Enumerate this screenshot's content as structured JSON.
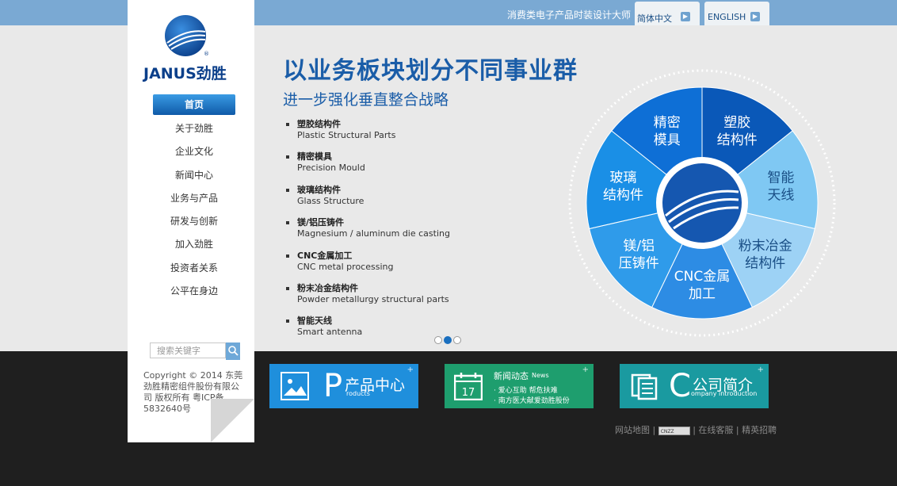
{
  "header": {
    "slogan": "消费类电子产品时装设计大师",
    "lang_cn": "简体中文",
    "lang_en": "ENGLISH"
  },
  "logo": {
    "brand_text": "JANUS劲胜"
  },
  "nav": {
    "items": [
      "首页",
      "关于劲胜",
      "企业文化",
      "新闻中心",
      "业务与产品",
      "研发与创新",
      "加入劲胜",
      "投资者关系",
      "公平在身边"
    ]
  },
  "search": {
    "placeholder": "搜索关键字"
  },
  "copyright": "Copyright © 2014 东莞劲胜精密组件股份有限公司 版权所有 粤ICP备5832640号",
  "banner": {
    "headline": "以业务板块划分不同事业群",
    "subhead": "进一步强化垂直整合战略",
    "businesses": [
      {
        "cn": "塑胶结构件",
        "en": "Plastic Structural Parts"
      },
      {
        "cn": "精密模具",
        "en": "Precision Mould"
      },
      {
        "cn": "玻璃结构件",
        "en": "Glass Structure"
      },
      {
        "cn": "镁/铝压铸件",
        "en": "Magnesium / aluminum die casting"
      },
      {
        "cn": "CNC金属加工",
        "en": "CNC metal processing"
      },
      {
        "cn": "粉末冶金结构件",
        "en": "Powder metallurgy structural parts"
      },
      {
        "cn": "智能天线",
        "en": "Smart antenna"
      }
    ],
    "wheel": [
      {
        "l1": "塑胶",
        "l2": "结构件",
        "color": "#0a58b8"
      },
      {
        "l1": "智能",
        "l2": "天线",
        "color": "#7fc8f3"
      },
      {
        "l1": "粉末冶金",
        "l2": "结构件",
        "color": "#9dd2f5"
      },
      {
        "l1": "CNC金属",
        "l2": "加工",
        "color": "#2d8ce4"
      },
      {
        "l1": "镁/铝",
        "l2": "压铸件",
        "color": "#2f9bea"
      },
      {
        "l1": "玻璃",
        "l2": "结构件",
        "color": "#1a8fe6"
      },
      {
        "l1": "精密",
        "l2": "模具",
        "color": "#0e6fd6"
      }
    ],
    "slide_count": 3,
    "active_slide": 2
  },
  "cards": {
    "products": {
      "big": "P",
      "title": "产品中心",
      "sub": "roducts",
      "color": "#1f8fdc"
    },
    "news": {
      "title": "新闻动态",
      "title_en": "News",
      "line1": "· 爱心互助 帮危扶难",
      "line2": "· 南方医大献爱劲胜股份",
      "icon_num": "17",
      "color": "#1e9e6e"
    },
    "company": {
      "big": "C",
      "title": "公司简介",
      "sub": "ompany introduction",
      "color": "#1a9aa0"
    }
  },
  "footer": {
    "sitemap": "网站地图",
    "cnzz": "CNZZ",
    "service": "在线客服",
    "jobs": "精英招聘"
  }
}
